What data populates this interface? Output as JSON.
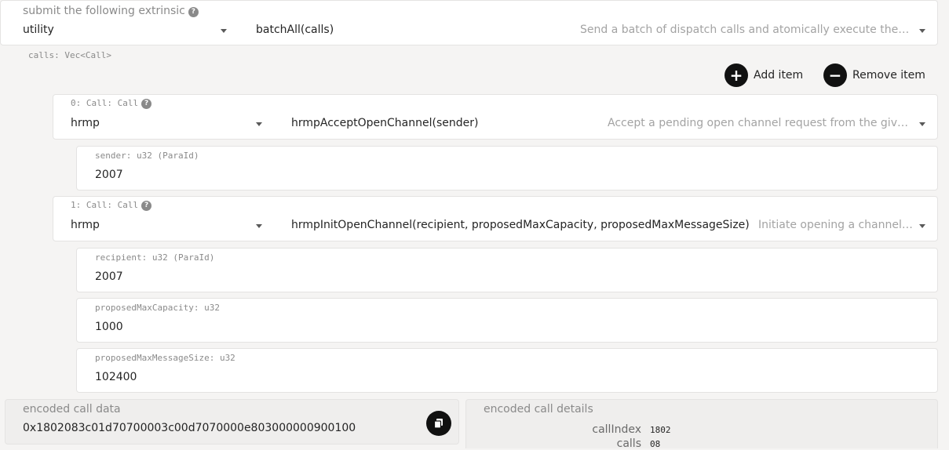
{
  "extrinsic": {
    "label": "submit the following extrinsic",
    "pallet": "utility",
    "method": "batchAll(calls)",
    "description": "Send a batch of dispatch calls and atomically execute them."
  },
  "calls_label": "calls: Vec<Call>",
  "actions": {
    "add": "Add item",
    "remove": "Remove item"
  },
  "calls": [
    {
      "label": "0: Call: Call",
      "pallet": "hrmp",
      "method": "hrmpAcceptOpenChannel(sender)",
      "description": "Accept a pending open channel request from the give…",
      "params": [
        {
          "label": "sender: u32 (ParaId)",
          "value": "2007"
        }
      ]
    },
    {
      "label": "1: Call: Call",
      "pallet": "hrmp",
      "method": "hrmpInitOpenChannel(recipient, proposedMaxCapacity, proposedMaxMessageSize)",
      "description": "Initiate opening a channel…",
      "params": [
        {
          "label": "recipient: u32 (ParaId)",
          "value": "2007"
        },
        {
          "label": "proposedMaxCapacity: u32",
          "value": "1000"
        },
        {
          "label": "proposedMaxMessageSize: u32",
          "value": "102400"
        }
      ]
    }
  ],
  "encoded": {
    "label": "encoded call data",
    "value": "0x1802083c01d70700003c00d7070000e803000000900100"
  },
  "details": {
    "label": "encoded call details",
    "rows": [
      {
        "key": "callIndex",
        "value": "1802"
      },
      {
        "key": "calls",
        "value": "08"
      }
    ]
  }
}
